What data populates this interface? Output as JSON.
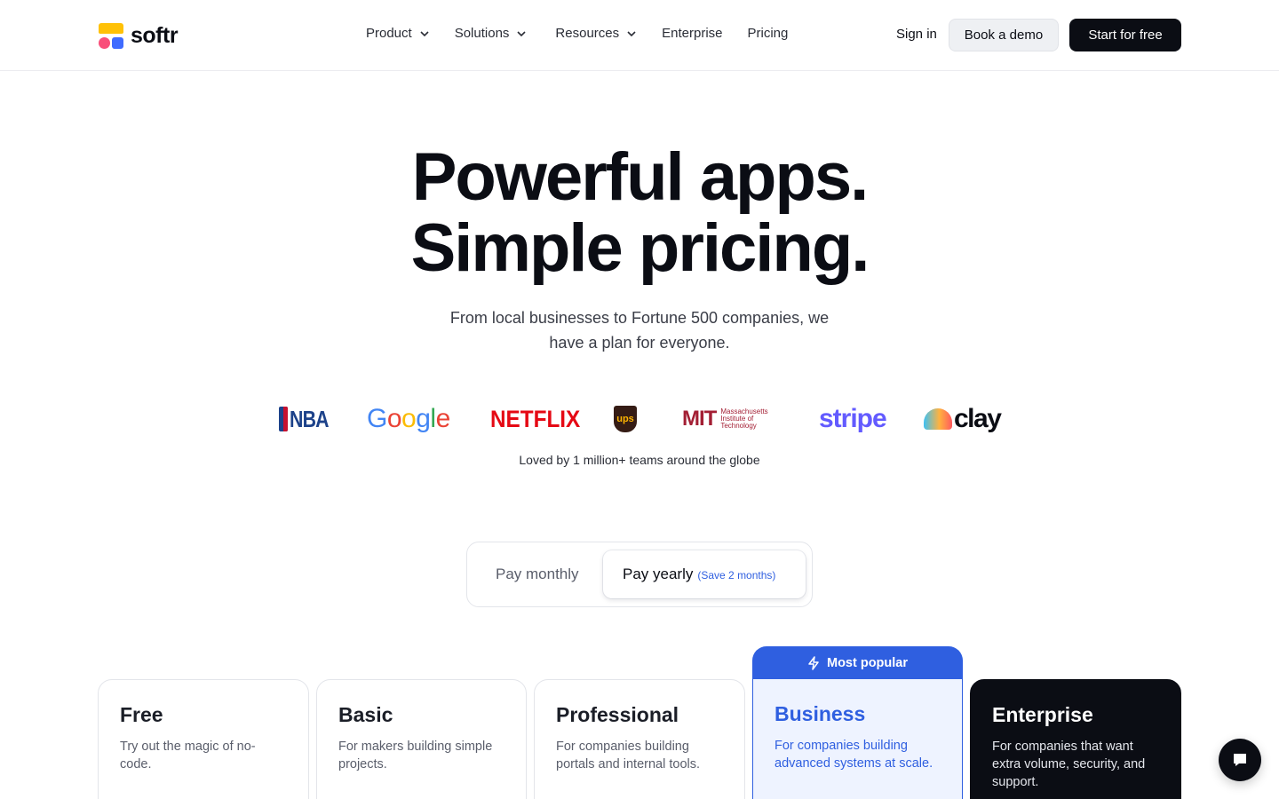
{
  "header": {
    "logo_text": "softr",
    "nav": [
      {
        "label": "Product",
        "has_dropdown": true
      },
      {
        "label": "Solutions",
        "has_dropdown": true
      },
      {
        "label": "Resources",
        "has_dropdown": true
      },
      {
        "label": "Enterprise",
        "has_dropdown": false
      },
      {
        "label": "Pricing",
        "has_dropdown": false
      }
    ],
    "sign_in": "Sign in",
    "book_demo": "Book a demo",
    "start_free": "Start for free"
  },
  "hero": {
    "title_line1": "Powerful apps.",
    "title_line2": "Simple pricing.",
    "subtitle": "From local businesses to Fortune 500 companies, we have a plan for everyone."
  },
  "logos": {
    "nba": "NBA",
    "google": [
      "G",
      "o",
      "o",
      "g",
      "l",
      "e"
    ],
    "google_colors": [
      "#4285F4",
      "#EA4335",
      "#FBBC05",
      "#4285F4",
      "#34A853",
      "#EA4335"
    ],
    "netflix": "NETFLIX",
    "ups": "ups",
    "mit_mark": "MIT",
    "mit_words": "Massachusetts Institute of Technology",
    "stripe": "stripe",
    "clay": "clay"
  },
  "loved_text": "Loved by 1 million+ teams around the globe",
  "billing_toggle": {
    "monthly": "Pay monthly",
    "yearly": "Pay yearly",
    "yearly_note": "(Save 2 months)",
    "selected": "yearly"
  },
  "plans": [
    {
      "name": "Free",
      "description": "Try out the magic of no-code."
    },
    {
      "name": "Basic",
      "description": "For makers building simple projects."
    },
    {
      "name": "Professional",
      "description": "For companies building portals and internal tools."
    },
    {
      "name": "Business",
      "description": "For companies building advanced systems at scale.",
      "badge": "Most popular"
    },
    {
      "name": "Enterprise",
      "description": "For companies that want extra volume, security, and support."
    }
  ],
  "colors": {
    "accent": "#2f5fe0",
    "dark": "#0b0d14",
    "business_bg": "#eef3ff"
  },
  "icons": {
    "chat": "chat-bubble-icon",
    "badge": "lightning-icon",
    "dropdown": "chevron-down-icon"
  }
}
